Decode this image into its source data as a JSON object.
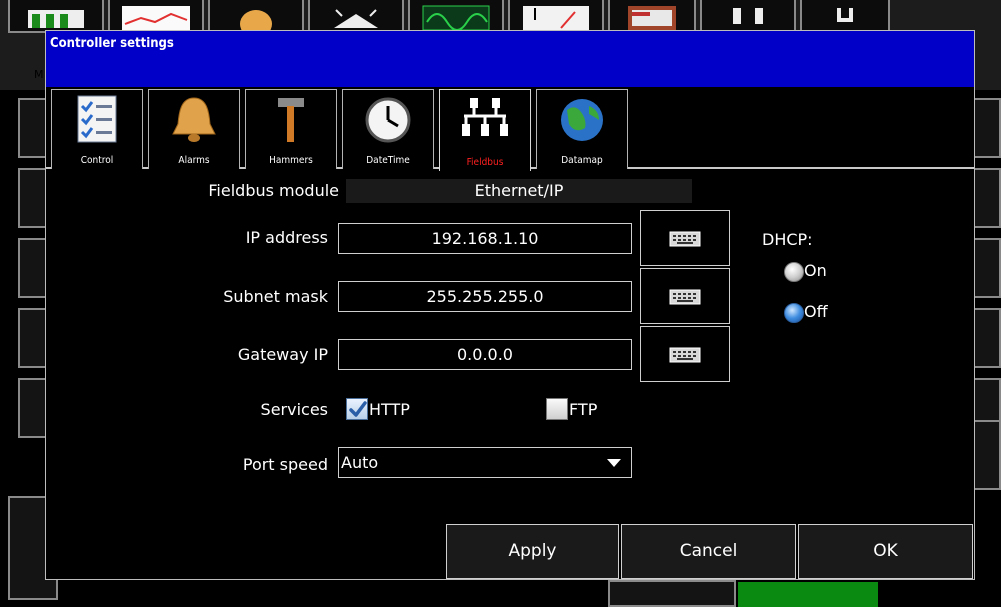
{
  "background": {
    "menu_letter": "M"
  },
  "dialog": {
    "title": "Controller settings"
  },
  "tabs": [
    {
      "label": "Control",
      "icon": "checklist-icon"
    },
    {
      "label": "Alarms",
      "icon": "bell-icon"
    },
    {
      "label": "Hammers",
      "icon": "hammer-icon"
    },
    {
      "label": "DateTime",
      "icon": "clock-icon"
    },
    {
      "label": "Fieldbus",
      "icon": "network-icon",
      "active": true
    },
    {
      "label": "Datamap",
      "icon": "globe-icon"
    }
  ],
  "fieldbus": {
    "module_label": "Fieldbus module",
    "module_value": "Ethernet/IP",
    "ip_label": "IP address",
    "ip_value": "192.168.1.10",
    "subnet_label": "Subnet mask",
    "subnet_value": "255.255.255.0",
    "gateway_label": "Gateway IP",
    "gateway_value": "0.0.0.0",
    "services_label": "Services",
    "http_label": "HTTP",
    "http_checked": true,
    "ftp_label": "FTP",
    "ftp_checked": false,
    "port_speed_label": "Port speed",
    "port_speed_value": "Auto"
  },
  "dhcp": {
    "label": "DHCP:",
    "on_label": "On",
    "off_label": "Off",
    "selected": "Off"
  },
  "buttons": {
    "apply": "Apply",
    "cancel": "Cancel",
    "ok": "OK"
  },
  "colors": {
    "titlebar": "#0000c8",
    "active_tab_label": "#ff2020",
    "background_green": "#0a8a10"
  }
}
